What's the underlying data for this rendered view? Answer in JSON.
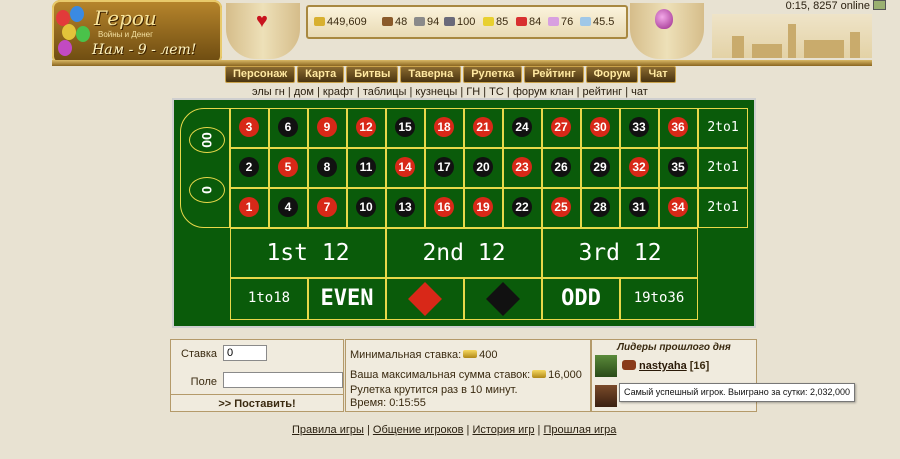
{
  "header": {
    "logo_title": "Герои",
    "logo_subtitle": "Войны и Денег",
    "logo_age": "Нам - 9 - лет!",
    "online_text": "0:15, 8257 online",
    "resources": [
      {
        "icon": "gold-icon",
        "value": "449,609"
      },
      {
        "icon": "wood-icon",
        "value": "48"
      },
      {
        "icon": "ore-icon",
        "value": "94"
      },
      {
        "icon": "mercury-icon",
        "value": "100"
      },
      {
        "icon": "sulfur-icon",
        "value": "85"
      },
      {
        "icon": "crystal-icon",
        "value": "84"
      },
      {
        "icon": "gems-icon",
        "value": "76"
      },
      {
        "icon": "diamond-icon",
        "value": "45.5"
      }
    ]
  },
  "nav": {
    "items": [
      "Персонаж",
      "Карта",
      "Битвы",
      "Таверна",
      "Рулетка",
      "Рейтинг",
      "Форум",
      "Чат"
    ]
  },
  "subnav": {
    "items": [
      "элы гн",
      "дом",
      "крафт",
      "таблицы",
      "кузнецы",
      "ГН",
      "ТС",
      "форум клан",
      "рейтинг",
      "чат"
    ]
  },
  "roulette": {
    "zeros": [
      "00",
      "0"
    ],
    "rows": [
      [
        {
          "n": "3",
          "c": "red"
        },
        {
          "n": "6",
          "c": "black"
        },
        {
          "n": "9",
          "c": "red"
        },
        {
          "n": "12",
          "c": "red"
        },
        {
          "n": "15",
          "c": "black"
        },
        {
          "n": "18",
          "c": "red"
        },
        {
          "n": "21",
          "c": "red"
        },
        {
          "n": "24",
          "c": "black"
        },
        {
          "n": "27",
          "c": "red"
        },
        {
          "n": "30",
          "c": "red"
        },
        {
          "n": "33",
          "c": "black"
        },
        {
          "n": "36",
          "c": "red"
        }
      ],
      [
        {
          "n": "2",
          "c": "black"
        },
        {
          "n": "5",
          "c": "red"
        },
        {
          "n": "8",
          "c": "black"
        },
        {
          "n": "11",
          "c": "black"
        },
        {
          "n": "14",
          "c": "red"
        },
        {
          "n": "17",
          "c": "black"
        },
        {
          "n": "20",
          "c": "black"
        },
        {
          "n": "23",
          "c": "red"
        },
        {
          "n": "26",
          "c": "black"
        },
        {
          "n": "29",
          "c": "black"
        },
        {
          "n": "32",
          "c": "red"
        },
        {
          "n": "35",
          "c": "black"
        }
      ],
      [
        {
          "n": "1",
          "c": "red"
        },
        {
          "n": "4",
          "c": "black"
        },
        {
          "n": "7",
          "c": "red"
        },
        {
          "n": "10",
          "c": "black"
        },
        {
          "n": "13",
          "c": "black"
        },
        {
          "n": "16",
          "c": "red"
        },
        {
          "n": "19",
          "c": "red"
        },
        {
          "n": "22",
          "c": "black"
        },
        {
          "n": "25",
          "c": "red"
        },
        {
          "n": "28",
          "c": "black"
        },
        {
          "n": "31",
          "c": "black"
        },
        {
          "n": "34",
          "c": "red"
        }
      ]
    ],
    "column_bets": [
      "2to1",
      "2to1",
      "2to1"
    ],
    "dozens": [
      "1st 12",
      "2nd 12",
      "3rd 12"
    ],
    "outer": {
      "low": "1to18",
      "even": "EVEN",
      "odd": "ODD",
      "high": "19to36"
    },
    "colors": {
      "felt": "#0a5b0a",
      "red": "#d82818",
      "black": "#111111",
      "line": "#e8d84a"
    }
  },
  "bet": {
    "stake_label": "Ставка",
    "stake_value": "0",
    "field_label": "Поле",
    "field_value": "",
    "submit_label": ">> Поставить!"
  },
  "info": {
    "min_bet_label": "Минимальная ставка:",
    "min_bet_value": "400",
    "max_sum_label": "Ваша максимальная сумма ставок:",
    "max_sum_value": "16,000",
    "spin_text": "Рулетка крутится раз в 10 минут.",
    "time_text": "Время: 0:15:55"
  },
  "leaders": {
    "title": "Лидеры прошлого дня",
    "player_name": "nastyaha",
    "player_level": "[16]",
    "tooltip": "Самый успешный игрок. Выиграно за сутки: 2,032,000"
  },
  "footer": {
    "links": [
      "Правила игры",
      "Общение игроков",
      "История игр",
      "Прошлая игра"
    ]
  }
}
